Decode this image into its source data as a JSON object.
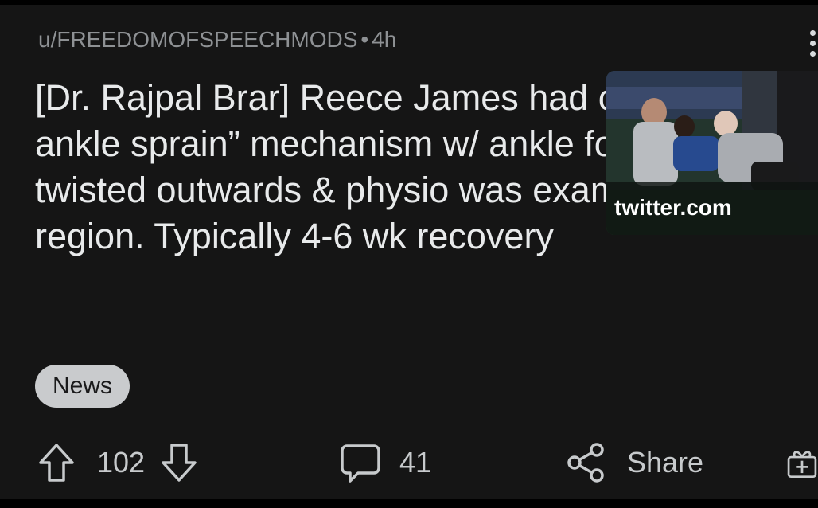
{
  "post": {
    "author": "u/FREEDOMOFSPEECHMODS",
    "separator": "•",
    "age": "4h",
    "title": "[Dr. Rajpal Brar] Reece James had classic “high ankle sprain” mechanism w/ ankle forcibly twisted outwards & physio was examining that region. Typically 4-6 wk recovery",
    "thumbnail_domain": "twitter.com",
    "flair": "News"
  },
  "actions": {
    "upvote_icon": "arrow-up-icon",
    "score": "102",
    "downvote_icon": "arrow-down-icon",
    "comment_icon": "speech-bubble-icon",
    "comments": "41",
    "share_icon": "share-nodes-icon",
    "share_label": "Share",
    "award_icon": "gift-icon"
  },
  "colors": {
    "background": "#151515",
    "text_primary": "#e8eaeb",
    "text_meta": "#8e9194",
    "flair_bg": "#c9cbcd"
  }
}
